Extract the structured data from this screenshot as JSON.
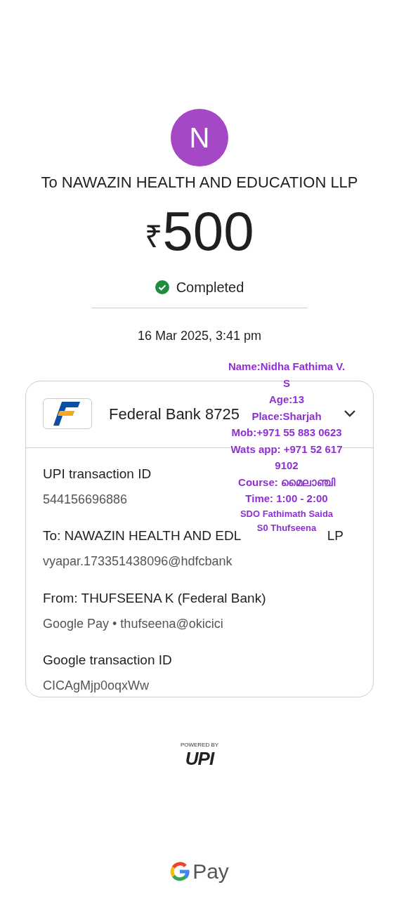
{
  "payee": {
    "avatar_letter": "N",
    "title": "To NAWAZIN HEALTH AND EDUCATION LLP"
  },
  "amount": {
    "currency": "₹",
    "value": "500"
  },
  "status": {
    "label": "Completed",
    "kind": "success"
  },
  "date": "16 Mar 2025, 3:41 pm",
  "details_card": {
    "bank": "Federal Bank 8725",
    "expanded": true,
    "rows": [
      {
        "label": "UPI transaction ID",
        "value": "544156696886"
      },
      {
        "label": "To: NAWAZIN HEALTH AND EDL",
        "label_tail": "LP",
        "value": "vyapar.173351438096@hdfcbank"
      },
      {
        "label": "From: THUFSEENA K (Federal Bank)",
        "value": "Google Pay • thufseena@okicici"
      },
      {
        "label": "Google transaction ID",
        "value": "CICAgMjp0oqxWw"
      }
    ]
  },
  "annotation": [
    {
      "text": "Name:Nidha Fathima V."
    },
    {
      "text": "S"
    },
    {
      "text": "Age:13"
    },
    {
      "text": "Place:Sharjah"
    },
    {
      "text": "Mob:+971 55 883 0623"
    },
    {
      "text": "Wats app: +971 52 617"
    },
    {
      "text": "9102"
    },
    {
      "text": "Course: മൈലാഞ്ചി"
    },
    {
      "text": "Time: 1:00 - 2:00"
    },
    {
      "text": "SDO Fathimath Saida",
      "small": true
    },
    {
      "text": "S0 Thufseena",
      "small": true
    }
  ],
  "footer": {
    "powered_by": "POWERED BY",
    "upi": "UPI",
    "brand": "Pay"
  }
}
